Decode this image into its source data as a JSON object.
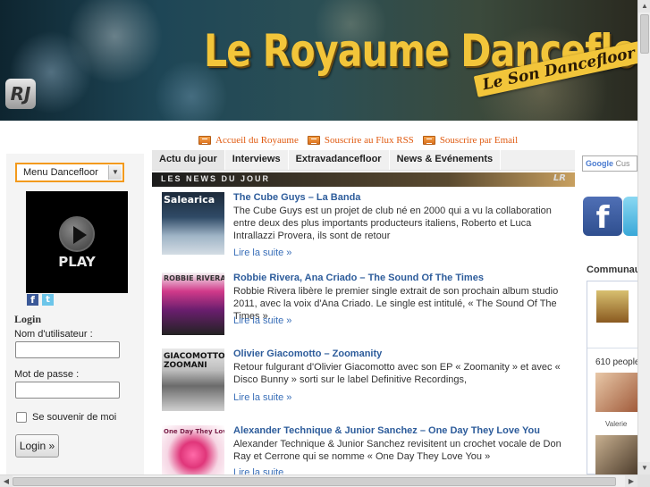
{
  "banner": {
    "title": "Le Royaume  Dancefloor",
    "subtitle": "Le Son Dancefloor !",
    "logo_text": "RJ"
  },
  "top_links": [
    {
      "label": "Accueil du Royaume",
      "icon": "rss-icon"
    },
    {
      "label": "Souscrire au Flux RSS",
      "icon": "rss-icon"
    },
    {
      "label": "Souscrire par Email",
      "icon": "rss-icon"
    }
  ],
  "sidebar": {
    "menu_select": "Menu Dancefloor",
    "player_label": "PLAY",
    "login": {
      "title": "Login",
      "username_label": "Nom d'utilisateur :",
      "password_label": "Mot de passe :",
      "remember_label": "Se souvenir de moi",
      "button_label": "Login »"
    }
  },
  "nav": {
    "tabs": [
      "Actu du jour",
      "Interviews",
      "Extravadancefloor",
      "News & Evénements"
    ]
  },
  "news_header": {
    "title": "LES NEWS DU JOUR",
    "logo": "LR"
  },
  "articles": [
    {
      "title": "The Cube Guys – La Banda",
      "excerpt": "The Cube Guys est un projet de club né en 2000 qui a vu la collaboration entre deux des plus importants producteurs italiens, Roberto et Luca Intrallazzi Provera, ils sont de retour",
      "more": "Lire la suite »",
      "thumb_text": "Salearica"
    },
    {
      "title": "Robbie Rivera, Ana Criado – The Sound Of The Times",
      "excerpt": "Robbie Rivera libère le premier single extrait de son prochain album studio 2011, avec la voix d'Ana Criado. Le single est intitulé, « The Sound Of The Times ».",
      "more": "Lire la suite »",
      "thumb_text": "ROBBIE RIVERA"
    },
    {
      "title": "Olivier Giacomotto – Zoomanity",
      "excerpt": "Retour fulgurant d'Olivier Giacomotto avec son EP « Zoomanity » et avec « Disco Bunny » sorti sur le label Definitive Recordings,",
      "more": "Lire la suite »",
      "thumb_text": "GIACOMOTTO ZOOMANI"
    },
    {
      "title": "Alexander Technique & Junior Sanchez – One Day They Love You",
      "excerpt": "Alexander Technique & Junior Sanchez revisitent un crochet vocale de Don Ray et Cerrone qui se nomme « One Day They Love You »",
      "more": "Lire la suite",
      "thumb_text": "One Day They Love You"
    }
  ],
  "right": {
    "search_brand": "Google",
    "search_placeholder": "Cus",
    "communaute": "Communau",
    "people_count": "610 people",
    "member_name": "Valerie"
  }
}
